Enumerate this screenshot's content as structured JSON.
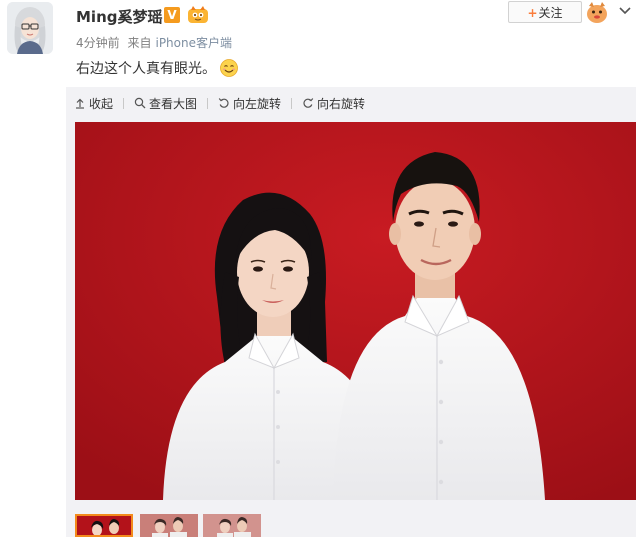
{
  "post": {
    "username": "Ming奚梦瑶",
    "verified_badge": "V",
    "time": "4分钟前",
    "source_prefix": "来自",
    "source": "iPhone客户端",
    "text": "右边这个人真有眼光。",
    "emoji": "smile-emoji"
  },
  "actions": {
    "follow_label": "关注",
    "follow_plus": "+"
  },
  "toolbar": {
    "collapse": "收起",
    "view_large": "查看大图",
    "rotate_left": "向左旋转",
    "rotate_right": "向右旋转"
  },
  "thumbnails": {
    "count": 3,
    "selected_index": 0
  },
  "colors": {
    "photo_background": "#b3121a",
    "verified_badge": "#f59b1f",
    "follow_plus": "#fa7d3c",
    "thumbnail_selected_border": "#f38b1c",
    "source_link": "#7d8ea1"
  },
  "icons": [
    "collapse-icon",
    "magnifier-icon",
    "rotate-left-icon",
    "rotate-right-icon",
    "chevron-down-icon",
    "member-badge-icon",
    "smile-emoji-icon"
  ]
}
